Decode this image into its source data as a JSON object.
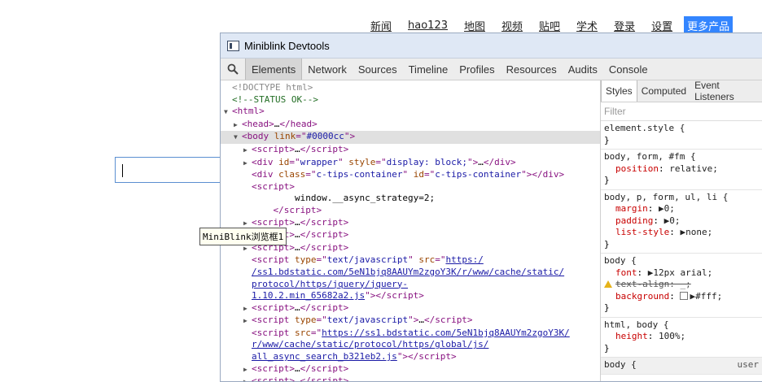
{
  "nav": {
    "links": [
      "新闻",
      "hao123",
      "地图",
      "视频",
      "贴吧",
      "学术",
      "登录",
      "设置"
    ],
    "more_button": "更多产品"
  },
  "tooltip": "MiniBlink浏览框1",
  "devtools": {
    "title": "Miniblink Devtools",
    "tabs": [
      "Elements",
      "Network",
      "Sources",
      "Timeline",
      "Profiles",
      "Resources",
      "Audits",
      "Console"
    ],
    "active_tab": "Elements",
    "dom_lines": [
      {
        "indent": 0,
        "tri": "",
        "html": "<span class='dim'>&lt;!DOCTYPE html&gt;</span>"
      },
      {
        "indent": 0,
        "tri": "",
        "html": "<span class='cm'>&lt;!--STATUS OK--&gt;</span>"
      },
      {
        "indent": 0,
        "tri": "▼",
        "html": "<span class='tag'>&lt;html&gt;</span>"
      },
      {
        "indent": 1,
        "tri": "▶",
        "html": "<span class='tag'>&lt;head&gt;</span>…<span class='tag'>&lt;/head&gt;</span>"
      },
      {
        "indent": 1,
        "tri": "▼",
        "sel": true,
        "html": "<span class='tag'>&lt;body </span><span class='an'>link</span><span class='tag'>=\"</span><span class='av'>#0000cc</span><span class='tag'>\"&gt;</span>"
      },
      {
        "indent": 2,
        "tri": "▶",
        "html": "<span class='tag'>&lt;script&gt;</span>…<span class='tag'>&lt;/script&gt;</span>"
      },
      {
        "indent": 2,
        "tri": "▶",
        "html": "<span class='tag'>&lt;div </span><span class='an'>id</span><span class='tag'>=\"</span><span class='av'>wrapper</span><span class='tag'>\" </span><span class='an'>style</span><span class='tag'>=\"</span><span class='av'>display: block;</span><span class='tag'>\"&gt;</span>…<span class='tag'>&lt;/div&gt;</span>"
      },
      {
        "indent": 2,
        "tri": "",
        "html": "<span class='tag'>&lt;div </span><span class='an'>class</span><span class='tag'>=\"</span><span class='av'>c-tips-container</span><span class='tag'>\" </span><span class='an'>id</span><span class='tag'>=\"</span><span class='av'>c-tips-container</span><span class='tag'>\"&gt;&lt;/div&gt;</span>"
      },
      {
        "indent": 2,
        "tri": "",
        "html": "<span class='tag'>&lt;script&gt;</span>"
      },
      {
        "indent": 2,
        "tri": "",
        "html": "<span class='txt'>        window.__async_strategy=2;</span>"
      },
      {
        "indent": 2,
        "tri": "",
        "html": "<span class='tag'>    &lt;/script&gt;</span>"
      },
      {
        "indent": 2,
        "tri": "▶",
        "html": "<span class='tag'>&lt;script&gt;</span>…<span class='tag'>&lt;/script&gt;</span>"
      },
      {
        "indent": 2,
        "tri": "▶",
        "html": "<span class='tag'>&lt;script&gt;</span>…<span class='tag'>&lt;/script&gt;</span>"
      },
      {
        "indent": 2,
        "tri": "▶",
        "html": "<span class='tag'>&lt;script&gt;</span>…<span class='tag'>&lt;/script&gt;</span>"
      },
      {
        "indent": 2,
        "tri": "",
        "html": "<span class='tag'>&lt;script </span><span class='an'>type</span><span class='tag'>=\"</span><span class='av'>text/javascript</span><span class='tag'>\" </span><span class='an'>src</span><span class='tag'>=\"</span><span class='lnk'>https:/</span>"
      },
      {
        "indent": 2,
        "tri": "",
        "html": "<span class='lnk'>/ss1.bdstatic.com/5eN1bjq8AAUYm2zgoY3K/r/www/cache/static/</span>"
      },
      {
        "indent": 2,
        "tri": "",
        "html": "<span class='lnk'>protocol/https/jquery/jquery-</span>"
      },
      {
        "indent": 2,
        "tri": "",
        "html": "<span class='lnk'>1.10.2.min_65682a2.js</span><span class='tag'>\"&gt;&lt;/script&gt;</span>"
      },
      {
        "indent": 2,
        "tri": "▶",
        "html": "<span class='tag'>&lt;script&gt;</span>…<span class='tag'>&lt;/script&gt;</span>"
      },
      {
        "indent": 2,
        "tri": "▶",
        "html": "<span class='tag'>&lt;script </span><span class='an'>type</span><span class='tag'>=\"</span><span class='av'>text/javascript</span><span class='tag'>\"&gt;</span>…<span class='tag'>&lt;/script&gt;</span>"
      },
      {
        "indent": 2,
        "tri": "",
        "html": "<span class='tag'>&lt;script </span><span class='an'>src</span><span class='tag'>=\"</span><span class='lnk'>https://ss1.bdstatic.com/5eN1bjq8AAUYm2zgoY3K/</span>"
      },
      {
        "indent": 2,
        "tri": "",
        "html": "<span class='lnk'>r/www/cache/static/protocol/https/global/js/</span>"
      },
      {
        "indent": 2,
        "tri": "",
        "html": "<span class='lnk'>all_async_search_b321eb2.js</span><span class='tag'>\"&gt;&lt;/script&gt;</span>"
      },
      {
        "indent": 2,
        "tri": "▶",
        "html": "<span class='tag'>&lt;script&gt;</span>…<span class='tag'>&lt;/script&gt;</span>"
      },
      {
        "indent": 2,
        "tri": "▶",
        "html": "<span class='tag'>&lt;script&gt;</span>…<span class='tag'>&lt;/script&gt;</span>"
      }
    ],
    "styles": {
      "tabs": [
        "Styles",
        "Computed",
        "Event Listeners"
      ],
      "active_tab": "Styles",
      "filter_placeholder": "Filter",
      "rules": [
        {
          "selector": "element.style {",
          "props": [],
          "close": "}"
        },
        {
          "selector": "body, form, #fm {",
          "props": [
            {
              "name": "position",
              "value": "relative;"
            }
          ],
          "close": "}"
        },
        {
          "selector": "body, p, form, ul, li {",
          "props": [
            {
              "name": "margin",
              "value": "▶0;"
            },
            {
              "name": "padding",
              "value": "▶0;"
            },
            {
              "name": "list-style",
              "value": "▶none;"
            }
          ],
          "close": "}"
        },
        {
          "selector": "body {",
          "props": [
            {
              "name": "font",
              "value": "▶12px arial;"
            },
            {
              "name": "text-align",
              "value": "_;",
              "struck": true,
              "warn": true
            },
            {
              "name": "background",
              "value": "▶#fff;",
              "swatch": true
            }
          ],
          "close": "}"
        },
        {
          "selector": "html, body {",
          "props": [
            {
              "name": "height",
              "value": "100%;"
            }
          ],
          "close": "}"
        },
        {
          "selector": "body {",
          "props": [],
          "close": "",
          "source": "user",
          "last": true
        }
      ]
    }
  }
}
